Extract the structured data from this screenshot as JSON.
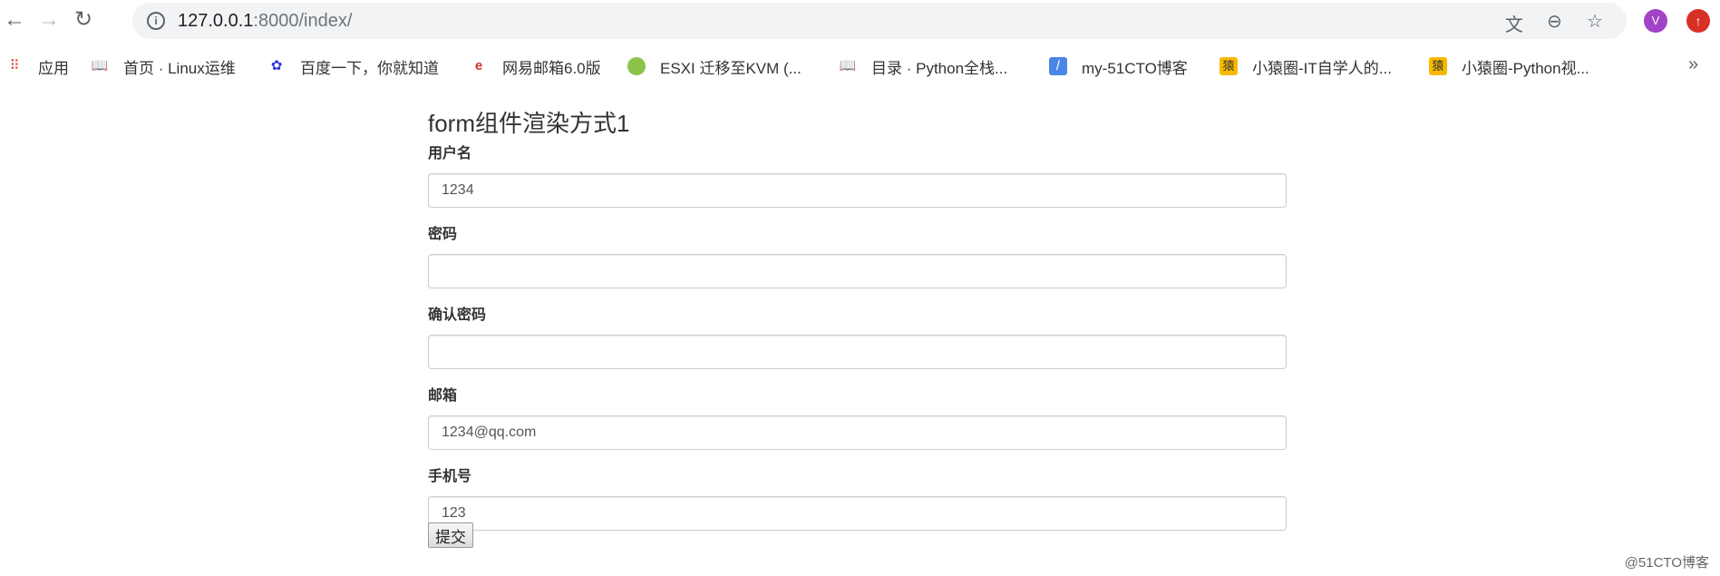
{
  "browser": {
    "url_host": "127.0.0.1",
    "url_rest": ":8000/index/",
    "avatar_letter": "V",
    "bookmarks": [
      {
        "label": "应用",
        "icon": "apps-grid-icon"
      },
      {
        "label": "首页 · Linux运维",
        "icon": "book-icon"
      },
      {
        "label": "百度一下，你就知道",
        "icon": "baidu-paw-icon"
      },
      {
        "label": "网易邮箱6.0版",
        "icon": "netease-mail-icon"
      },
      {
        "label": "ESXI 迁移至KVM (...",
        "icon": "frog-icon"
      },
      {
        "label": "目录 · Python全栈...",
        "icon": "book-icon"
      },
      {
        "label": "my-51CTO博客",
        "icon": "feather-icon"
      },
      {
        "label": "小猿圈-IT自学人的...",
        "icon": "yuan-icon"
      },
      {
        "label": "小猿圈-Python视...",
        "icon": "yuan-icon"
      }
    ],
    "more_label": "»"
  },
  "form": {
    "title": "form组件渲染方式1",
    "fields": [
      {
        "label": "用户名",
        "value": ""
      },
      {
        "label": "密码",
        "value": ""
      },
      {
        "label": "确认密码",
        "value": ""
      },
      {
        "label": "邮箱",
        "value": ""
      },
      {
        "label": "手机号",
        "value": ""
      }
    ],
    "values": [
      "1234",
      "",
      "",
      "1234@qq.com",
      "123"
    ],
    "submit_label": "提交"
  },
  "watermark": "@51CTO博客"
}
